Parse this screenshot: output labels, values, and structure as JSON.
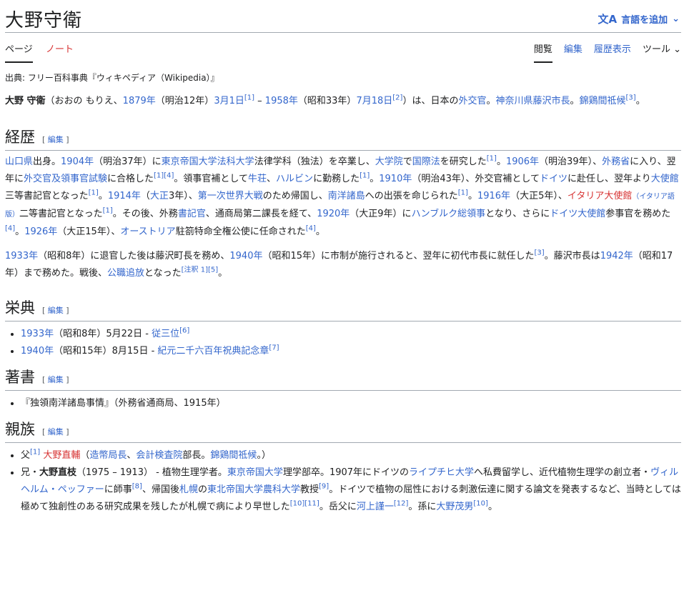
{
  "header": {
    "title": "大野守衛",
    "add_lang_icon": "文A",
    "add_lang": "言語を追加",
    "chevron": "⌄"
  },
  "tabs": {
    "page": "ページ",
    "note": "ノート",
    "read": "閲覧",
    "edit": "編集",
    "history": "履歴表示",
    "tools": "ツール"
  },
  "from": "出典: フリー百科事典『ウィキペディア（Wikipedia）』",
  "edit_label": "編集",
  "sections": {
    "career": "経歴",
    "honors": "栄典",
    "works": "著書",
    "family": "親族"
  },
  "works": {
    "item1": "『独領南洋諸島事情』（外務省通商局、1915年）"
  },
  "colors": {
    "link": "#3366cc",
    "redlink": "#d73333",
    "text": "#202122"
  }
}
